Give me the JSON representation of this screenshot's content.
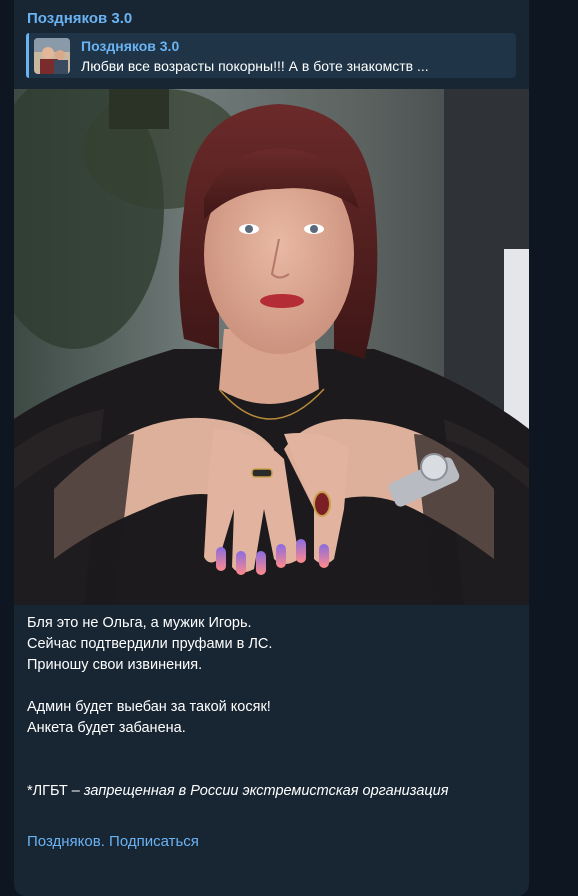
{
  "message": {
    "sender": "Поздняков 3.0",
    "reply": {
      "title": "Поздняков 3.0",
      "text": "Любви все возрасты покорны!!!  А в боте знакомств ..."
    },
    "body": {
      "line1": "Бля это не Ольга, а мужик Игорь.",
      "line2": "Сейчас подтвердили пруфами в ЛС.",
      "line3": "Приношу свои извинения.",
      "line4": "Админ будет выебан за такой косяк!",
      "line5": "Анкета будет забанена.",
      "note_prefix": "*ЛГБТ",
      "note_rest": " – запрещенная в России экстремистская организация"
    },
    "footer": {
      "link1": "Поздняков.",
      "link2": "Подписаться"
    }
  },
  "colors": {
    "background": "#0e1621",
    "bubble": "#182533",
    "accent": "#6ab3f3",
    "text": "#ffffff"
  }
}
